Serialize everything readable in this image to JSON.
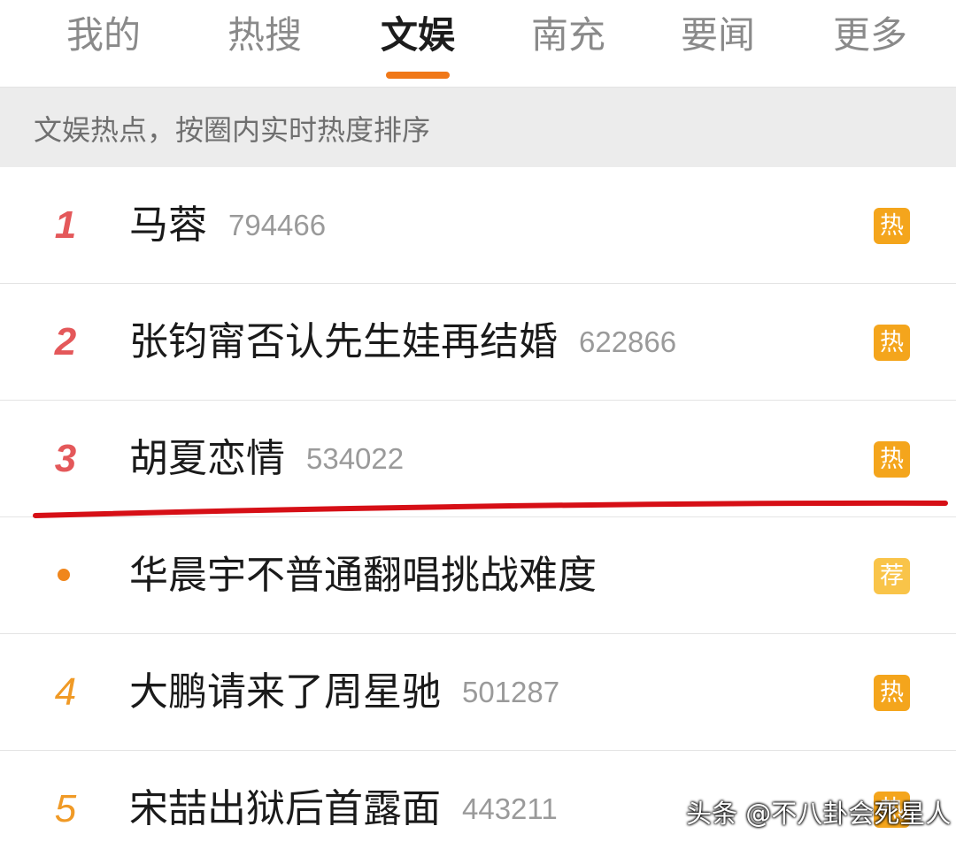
{
  "tabs": [
    {
      "label": "我的",
      "active": false
    },
    {
      "label": "热搜",
      "active": false
    },
    {
      "label": "文娱",
      "active": true
    },
    {
      "label": "南充",
      "active": false
    },
    {
      "label": "要闻",
      "active": false
    },
    {
      "label": "更多",
      "active": false
    }
  ],
  "notice": {
    "text": "文娱热点，按圈内实时热度排序"
  },
  "list": {
    "items": [
      {
        "rank": "1",
        "title": "马蓉",
        "count": "794466",
        "badge": "热"
      },
      {
        "rank": "2",
        "title": "张钧甯否认先生娃再结婚",
        "count": "622866",
        "badge": "热"
      },
      {
        "rank": "3",
        "title": "胡夏恋情",
        "count": "534022",
        "badge": "热"
      },
      {
        "rank": "",
        "title": "华晨宇不普通翻唱挑战难度",
        "count": "",
        "badge": "荐"
      },
      {
        "rank": "4",
        "title": "大鹏请来了周星驰",
        "count": "501287",
        "badge": "热"
      },
      {
        "rank": "5",
        "title": "宋喆出狱后首露面",
        "count": "443211",
        "badge": "热"
      }
    ]
  },
  "watermark": {
    "text": "头条 @不八卦会死星人"
  },
  "colors": {
    "accent": "#f07818",
    "top_rank": "#e4585a",
    "normal_rank": "#f09a26",
    "hot_badge": "#f4a51c",
    "recommend_badge": "#f9c449",
    "annotation_line": "#d60f16"
  },
  "icons": {
    "hot_badge": "hot-badge-icon",
    "recommend_badge": "recommend-badge-icon",
    "promo_dot": "dot-icon"
  }
}
